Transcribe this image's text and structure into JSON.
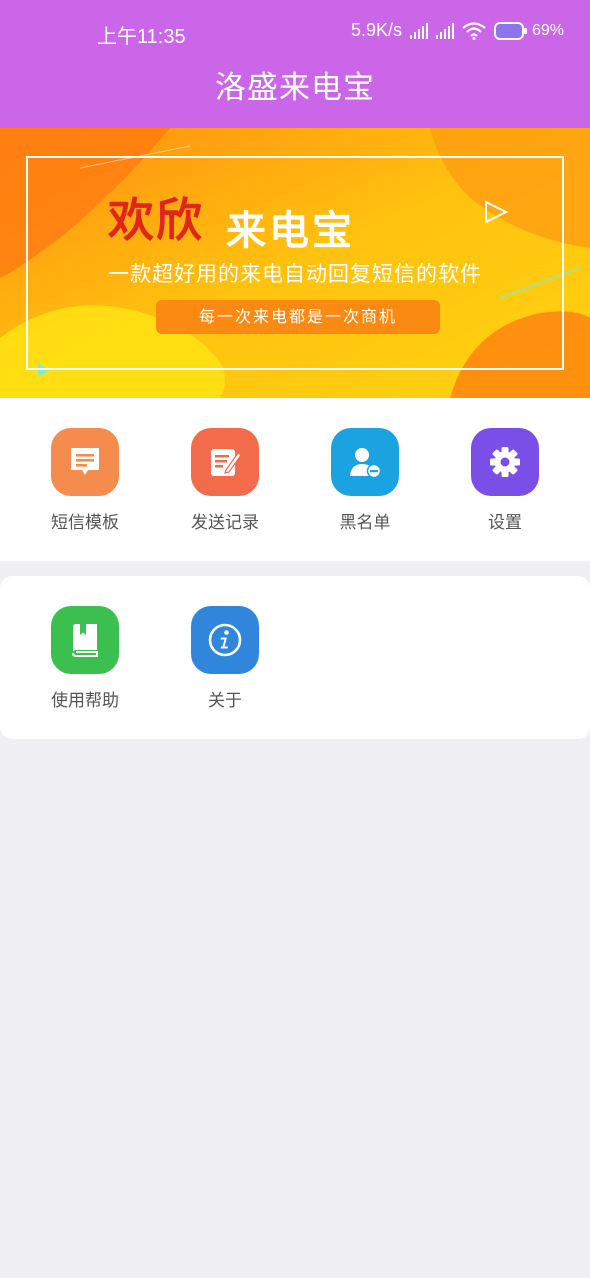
{
  "status_bar": {
    "time": "上午11:35",
    "net_speed": "5.9K/s",
    "battery": "69%"
  },
  "header": {
    "title": "洛盛来电宝"
  },
  "banner": {
    "welcome": "欢欣",
    "app_name": "来电宝",
    "description": "一款超好用的来电自动回复短信的软件",
    "slogan": "每一次来电都是一次商机"
  },
  "menu_row1": [
    {
      "label": "短信模板",
      "icon": "sms-template-icon",
      "color": "#f58b4c"
    },
    {
      "label": "发送记录",
      "icon": "send-record-icon",
      "color": "#f26b4b"
    },
    {
      "label": "黑名单",
      "icon": "blacklist-icon",
      "color": "#1aa3e0"
    },
    {
      "label": "设置",
      "icon": "settings-gear-icon",
      "color": "#7a4fe8"
    }
  ],
  "menu_row2": [
    {
      "label": "使用帮助",
      "icon": "help-book-icon",
      "color": "#3bbf4f"
    },
    {
      "label": "关于",
      "icon": "about-info-icon",
      "color": "#2f86da"
    }
  ]
}
